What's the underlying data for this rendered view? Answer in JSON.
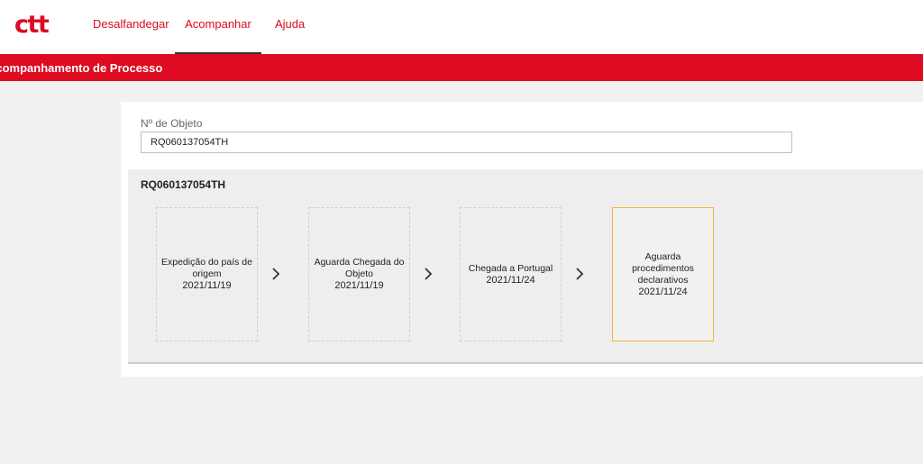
{
  "brand": {
    "logo_text": "ctt",
    "color": "#dd0a21"
  },
  "nav": {
    "items": [
      {
        "label": "Desalfandegar",
        "active": false
      },
      {
        "label": "Acompanhar",
        "active": true
      },
      {
        "label": "Ajuda",
        "active": false
      }
    ]
  },
  "page": {
    "title": "Acompanhamento de Processo"
  },
  "search": {
    "label": "Nº de Objeto",
    "value": "RQ060137054TH"
  },
  "result": {
    "object_number": "RQ060137054TH",
    "steps": [
      {
        "label": "Expedição do país de origem",
        "date": "2021/11/19",
        "current": false
      },
      {
        "label": "Aguarda Chegada do Objeto",
        "date": "2021/11/19",
        "current": false
      },
      {
        "label": "Chegada a Portugal",
        "date": "2021/11/24",
        "current": false
      },
      {
        "label": "Aguarda procedimentos declarativos",
        "date": "2021/11/24",
        "current": true
      }
    ]
  },
  "icons": {
    "step_separator": "chevron-right-icon"
  },
  "colors": {
    "current_step_border": "#f3b536"
  }
}
